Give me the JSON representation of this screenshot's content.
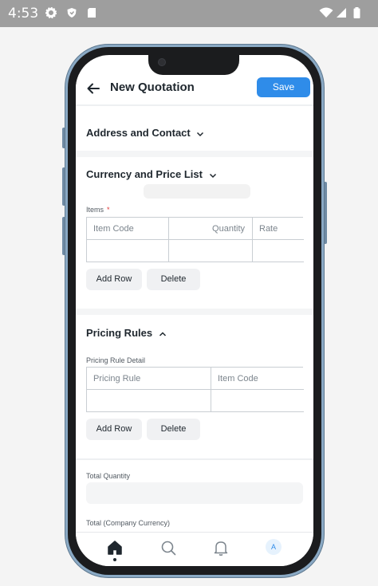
{
  "status_bar": {
    "time": "4:53",
    "left_icons": [
      "gear-icon",
      "shield-icon",
      "sd-card-icon"
    ],
    "right_icons": [
      "wifi-icon",
      "signal-icon",
      "battery-icon"
    ]
  },
  "app_bar": {
    "back_icon": "arrow-left-icon",
    "title": "New Quotation",
    "save_label": "Save"
  },
  "sections": {
    "address": {
      "title": "Address and Contact",
      "icon": "chevron-down-icon"
    },
    "currency": {
      "title": "Currency and Price List",
      "icon": "chevron-down-icon"
    },
    "items": {
      "label": "Items",
      "required_mark": "*",
      "columns": [
        "Item Code",
        "Quantity",
        "Rate"
      ],
      "add_row": "Add Row",
      "delete": "Delete"
    },
    "pricing": {
      "title": "Pricing Rules",
      "icon": "chevron-up-icon",
      "table_label": "Pricing Rule Detail",
      "columns": [
        "Pricing Rule",
        "Item Code"
      ],
      "add_row": "Add Row",
      "delete": "Delete"
    },
    "totals": {
      "total_quantity_label": "Total Quantity",
      "total_currency_label": "Total (Company Currency)"
    }
  },
  "bottom_nav": {
    "items": [
      "home-icon",
      "search-icon",
      "bell-icon",
      "avatar"
    ],
    "avatar_letter": "A",
    "active": "home-icon"
  },
  "colors": {
    "primary": "#2f8ce9",
    "text": "#1f272e",
    "required": "#e03636",
    "phone_frame": "#8aa9c4"
  }
}
